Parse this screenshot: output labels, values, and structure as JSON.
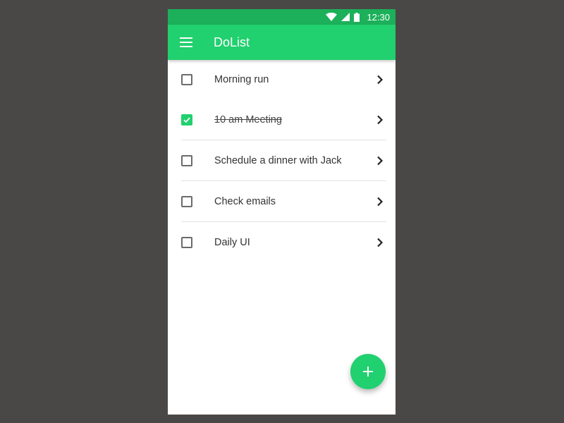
{
  "status_bar": {
    "time": "12:30",
    "icons": [
      "wifi-icon",
      "cellular-signal-icon",
      "battery-icon"
    ]
  },
  "app_bar": {
    "title": "DoList",
    "menu_icon": "menu-icon"
  },
  "tasks": [
    {
      "label": "Morning run",
      "checked": false
    },
    {
      "label": "10 am Meeting",
      "checked": true
    },
    {
      "label": "Schedule a dinner with Jack",
      "checked": false
    },
    {
      "label": "Check emails",
      "checked": false
    },
    {
      "label": "Daily UI",
      "checked": false
    }
  ],
  "fab": {
    "icon": "add-icon"
  },
  "colors": {
    "accent": "#21d06e",
    "status_bar": "#1cb05a",
    "background": "#4a4846"
  }
}
